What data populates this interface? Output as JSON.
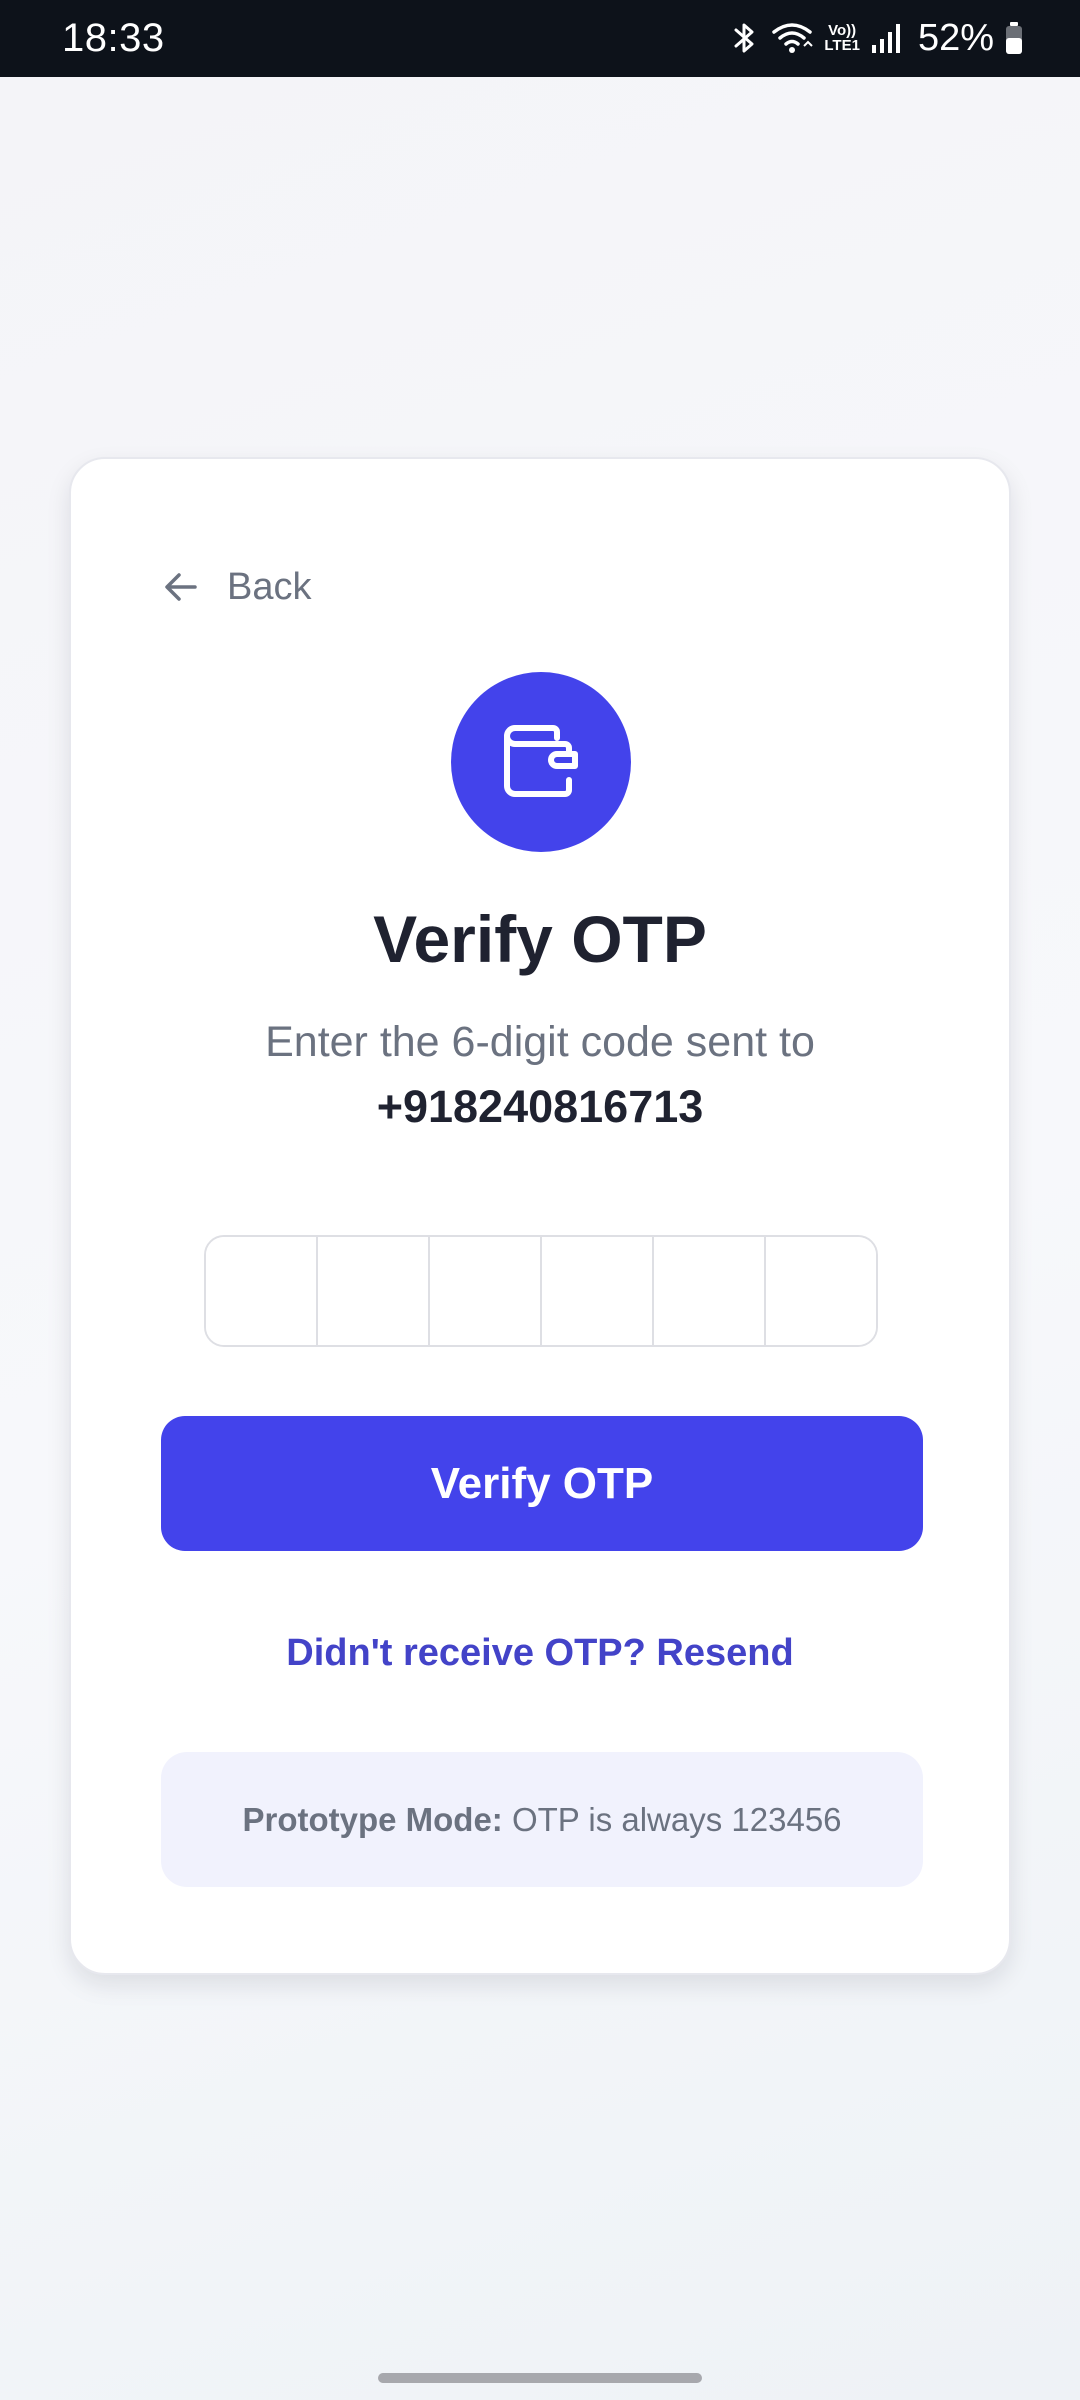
{
  "status_bar": {
    "time": "18:33",
    "network_label_top": "Vo))",
    "network_label_bottom": "LTE1",
    "battery": "52%"
  },
  "back": {
    "label": "Back"
  },
  "header": {
    "title": "Verify OTP",
    "subtitle": "Enter the 6-digit code sent to",
    "phone": "+918240816713"
  },
  "otp": {
    "digits": [
      "",
      "",
      "",
      "",
      "",
      ""
    ]
  },
  "actions": {
    "verify_label": "Verify OTP",
    "resend_label": "Didn't receive OTP? Resend"
  },
  "note": {
    "strong": "Prototype Mode:",
    "text": " OTP is always 123456"
  },
  "colors": {
    "accent": "#4343eb",
    "link": "#4343c8",
    "note_bg": "#f1f2fd",
    "status_bar_bg": "#0d121a"
  },
  "icons": [
    "bluetooth-icon",
    "wifi-icon",
    "signal-icon",
    "battery-icon",
    "arrow-left-icon",
    "wallet-icon"
  ]
}
